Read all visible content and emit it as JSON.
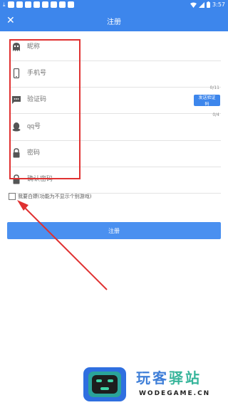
{
  "status": {
    "time": "3:57",
    "download_glyph": "⤓",
    "icons": [
      "download-icon",
      "app-icon",
      "app-icon",
      "app-icon",
      "app-icon",
      "app-icon",
      "app-icon",
      "app-icon",
      "app-icon"
    ]
  },
  "appbar": {
    "close_glyph": "✕",
    "title": "注册"
  },
  "fields": [
    {
      "placeholder": "昵称",
      "icon": "ghost-icon"
    },
    {
      "placeholder": "手机号",
      "icon": "phone-icon"
    },
    {
      "placeholder": "验证码",
      "icon": "message-icon"
    },
    {
      "placeholder": "qq号",
      "icon": "qq-icon"
    },
    {
      "placeholder": "密码",
      "icon": "lock-icon"
    },
    {
      "placeholder": "确认密码",
      "icon": "lock-icon"
    }
  ],
  "phone_counter": "0/11",
  "qq_counter": "0/4",
  "send_code_label": "发送验证码",
  "checkbox_label": "我要白嫖(功能为不显示个别游戏)",
  "submit_label": "注册",
  "watermark": {
    "cn_a": "玩客",
    "cn_b": "驿站",
    "url": "WODEGAME.CN"
  },
  "colors": {
    "primary": "#3d86ec",
    "button": "#4a90f0",
    "annotation": "#e03131"
  }
}
